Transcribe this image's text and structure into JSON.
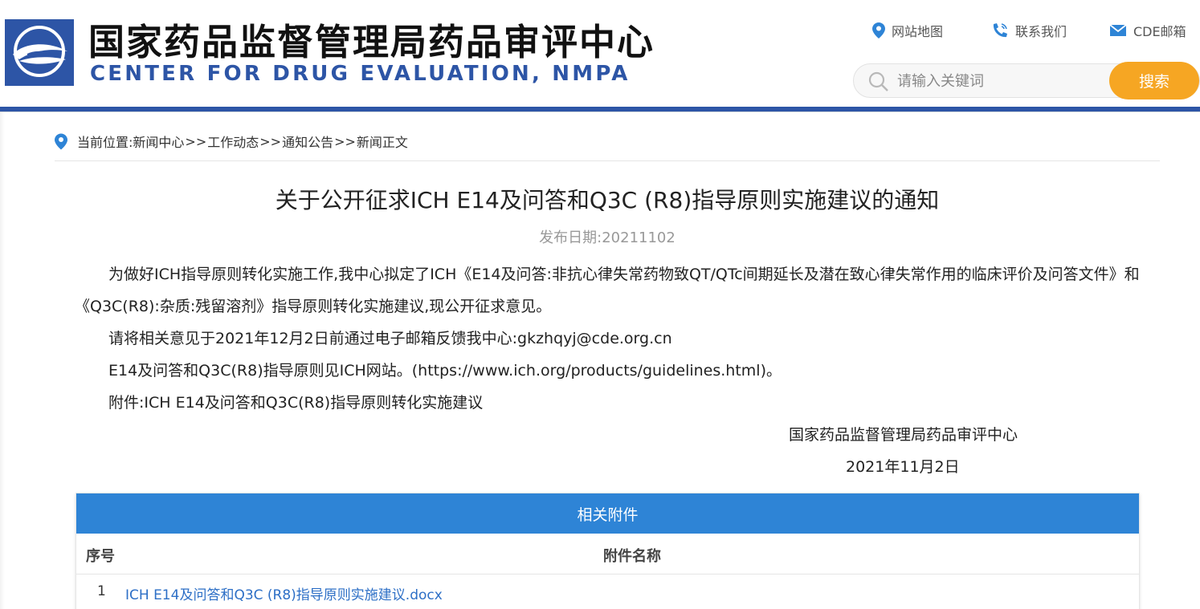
{
  "header": {
    "title_cn": "国家药品监督管理局药品审评中心",
    "title_en": "CENTER FOR DRUG EVALUATION, NMPA",
    "links": {
      "sitemap": "网站地图",
      "contact": "联系我们",
      "mail": "CDE邮箱"
    },
    "search": {
      "placeholder": "请输入关键词",
      "button": "搜索"
    }
  },
  "breadcrumb": {
    "label": "当前位置:",
    "items": [
      "新闻中心",
      "工作动态",
      "通知公告",
      "新闻正文"
    ],
    "separator": ">>"
  },
  "article": {
    "title": "关于公开征求ICH E14及问答和Q3C (R8)指导原则实施建议的通知",
    "date": "发布日期:20211102",
    "paragraphs": [
      "为做好ICH指导原则转化实施工作,我中心拟定了ICH《E14及问答:非抗心律失常药物致QT/QTc间期延长及潜在致心律失常作用的临床评价及问答文件》和《Q3C(R8):杂质:残留溶剂》指导原则转化实施建议,现公开征求意见。",
      "请将相关意见于2021年12月2日前通过电子邮箱反馈我中心:gkzhqyj@cde.org.cn",
      "E14及问答和Q3C(R8)指导原则见ICH网站。(https://www.ich.org/products/guidelines.html)。",
      "附件:ICH E14及问答和Q3C(R8)指导原则转化实施建议"
    ],
    "signature_org": "国家药品监督管理局药品审评中心",
    "signature_date": "2021年11月2日"
  },
  "attachments": {
    "heading": "相关附件",
    "columns": [
      "序号",
      "附件名称"
    ],
    "rows": [
      {
        "no": "1",
        "name": "ICH E14及问答和Q3C (R8)指导原则实施建议.docx"
      }
    ]
  },
  "colors": {
    "brand_blue": "#2d55a6",
    "search_orange": "#f6a623",
    "table_header_blue": "#2e84d6",
    "link_blue": "#2d6fc6"
  },
  "icons": [
    "logo-icon",
    "location-pin-icon",
    "phone-icon",
    "mail-icon",
    "search-icon"
  ]
}
